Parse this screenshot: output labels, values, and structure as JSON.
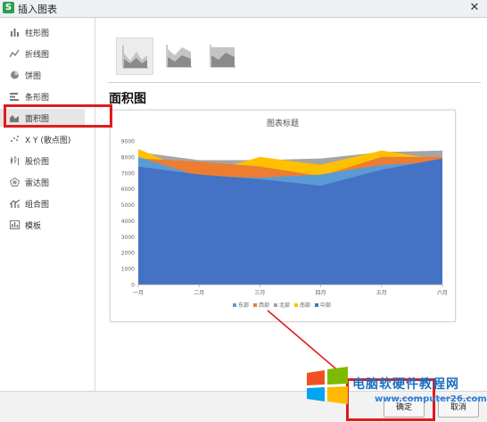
{
  "window": {
    "title": "插入图表",
    "app_icon": "S",
    "close_glyph": "✕"
  },
  "sidebar": {
    "items": [
      {
        "label": "柱形图",
        "icon": "column-chart-icon"
      },
      {
        "label": "折线图",
        "icon": "line-chart-icon"
      },
      {
        "label": "饼图",
        "icon": "pie-chart-icon"
      },
      {
        "label": "条形图",
        "icon": "bar-chart-icon"
      },
      {
        "label": "面积图",
        "icon": "area-chart-icon",
        "selected": true
      },
      {
        "label": "X Y (散点图)",
        "icon": "scatter-chart-icon"
      },
      {
        "label": "股价图",
        "icon": "stock-chart-icon"
      },
      {
        "label": "雷达图",
        "icon": "radar-chart-icon"
      },
      {
        "label": "组合图",
        "icon": "combo-chart-icon"
      },
      {
        "label": "模板",
        "icon": "template-icon"
      }
    ]
  },
  "content": {
    "heading": "面积图",
    "subtypes": [
      "area",
      "stacked-area",
      "percent-stacked-area"
    ],
    "selected_subtype": 0
  },
  "buttons": {
    "ok": "确定",
    "cancel": "取消"
  },
  "watermark": {
    "text": "电脑软硬件教程网",
    "url": "www.computer26.com"
  },
  "colors": {
    "accent_red": "#e01b1b",
    "selected_bg": "#e6e6e6"
  },
  "chart_data": {
    "type": "area",
    "title": "图表标题",
    "categories": [
      "一月",
      "二月",
      "三月",
      "四月",
      "五月",
      "六月"
    ],
    "ylim": [
      0,
      9000
    ],
    "yticks": [
      0,
      1000,
      2000,
      3000,
      4000,
      5000,
      6000,
      7000,
      8000,
      9000
    ],
    "series": [
      {
        "name": "北部",
        "color": "#a5a5a5",
        "values": [
          8300,
          7800,
          7800,
          7900,
          8300,
          8400
        ]
      },
      {
        "name": "南部",
        "color": "#ffc000",
        "values": [
          8500,
          6900,
          8000,
          7500,
          8400,
          7800
        ]
      },
      {
        "name": "西部",
        "color": "#ed7d31",
        "values": [
          7900,
          7700,
          7400,
          6800,
          8000,
          8000
        ]
      },
      {
        "name": "东部",
        "color": "#5b9bd5",
        "values": [
          8000,
          6800,
          6700,
          6900,
          7500,
          7700
        ]
      },
      {
        "name": "中部",
        "color": "#4472c4",
        "values": [
          7400,
          6900,
          6600,
          6200,
          7200,
          7900
        ]
      }
    ],
    "legend_order": [
      "东部",
      "西部",
      "北部",
      "南部",
      "中部"
    ],
    "legend_position": "bottom",
    "grid": false
  }
}
